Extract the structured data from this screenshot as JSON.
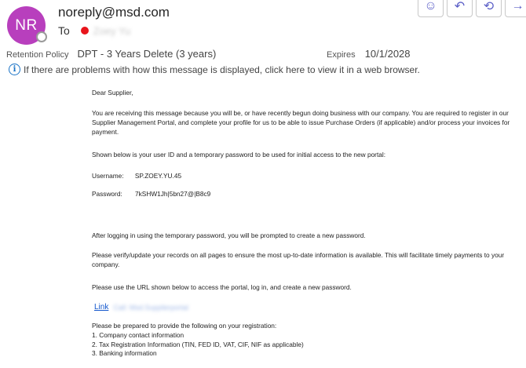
{
  "header": {
    "avatar_initials": "NR",
    "sender": "noreply@msd.com",
    "to_label": "To",
    "to_name": "Zoey Yu",
    "actions": [
      {
        "icon": "emoji-smile-icon",
        "glyph": "☺"
      },
      {
        "icon": "reply-icon",
        "glyph": "↶"
      },
      {
        "icon": "reply-all-icon",
        "glyph": "⟲"
      },
      {
        "icon": "forward-icon",
        "glyph": "→"
      }
    ]
  },
  "retention": {
    "label": "Retention Policy",
    "value": "DPT - 3 Years Delete (3 years)",
    "expires_label": "Expires",
    "expires_value": "10/1/2028"
  },
  "info_bar": {
    "icon": "info-icon",
    "text": "If there are problems with how this message is displayed, click here to view it in a web browser."
  },
  "email": {
    "greeting": "Dear Supplier,",
    "para1": "You are receiving this message because you will be, or have recently begun doing business with our company. You are required to register in our Supplier Management Portal, and complete your profile for us to be able to issue Purchase Orders (if applicable) and/or process your invoices for payment.",
    "para2": "Shown below is your user ID and a temporary password to be used for initial access to the new portal:",
    "username_label": "Username:",
    "username_value": "SP.ZOEY.YU.45",
    "password_label": "Password:",
    "password_value": "7kSHW1Jh|5bn27@|B8c9",
    "para3": "After logging in using the temporary password, you will be prompted to create a new password.",
    "para4": "Please verify/update your records on all pages to ensure the most up-to-date information is available. This will facilitate timely payments to your company.",
    "para5": "Please use the URL shown below to access the portal, log in, and create a new password.",
    "link_label": "Link",
    "link_url": "Call: Msd.Supplierportal",
    "para6": "Please be prepared to provide the following on your registration:",
    "list": [
      "1. Company contact information",
      "2. Tax Registration Information (TIN, FED ID, VAT, CIF, NIF as applicable)",
      "3. Banking information"
    ]
  }
}
